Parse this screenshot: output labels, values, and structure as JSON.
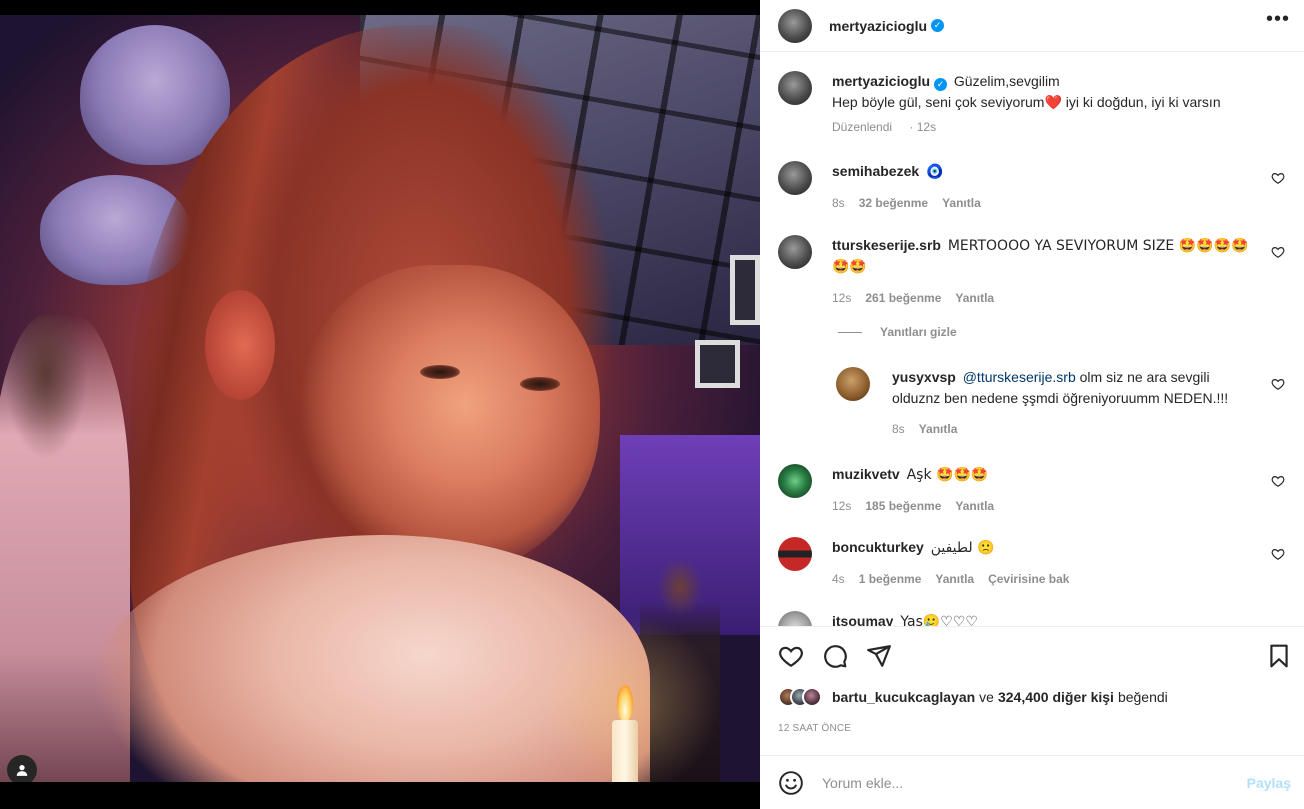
{
  "post": {
    "author": "mertyazicioglu",
    "caption_line1": "Güzelim,sevgilim",
    "caption_line2_part1": "Hep böyle gül, seni çok seviyorum",
    "caption_heart": "❤️",
    "caption_line2_part2": " iyi ki doğdun, iyi ki varsın",
    "edited": "Düzenlendi",
    "edited_time": "12s"
  },
  "comments": [
    {
      "user": "semihabezek",
      "text": "🧿",
      "time": "8s",
      "likes": "32 beğenme",
      "reply": "Yanıtla"
    },
    {
      "user": "tturskeserije.srb",
      "text": "MERTOOOO YA SEVIYORUM SIZE 🤩🤩🤩🤩",
      "text2": "🤩🤩",
      "time": "12s",
      "likes": "261 beğenme",
      "reply": "Yanıtla"
    },
    {
      "user": "yusyxvsp",
      "mention": "@tturskeserije.srb",
      "text": " olm siz ne ara sevgili",
      "text2": "olduznz ben nedene şşmdi öğreniyoruumm NEDEN.!!!",
      "time": "8s",
      "reply": "Yanıtla"
    },
    {
      "user": "muzikvetv",
      "text": "Aşk 🤩🤩🤩",
      "time": "12s",
      "likes": "185 beğenme",
      "reply": "Yanıtla"
    },
    {
      "user": "boncukturkey",
      "text": "لطيفين 🙁",
      "time": "4s",
      "likes": "1 beğenme",
      "reply": "Yanıtla",
      "translate": "Çevirisine bak"
    },
    {
      "user": "itsoumay",
      "text": "Yas🥲♡♡♡"
    }
  ],
  "hide_replies": "Yanıtları gizle",
  "likes": {
    "user": "bartu_kucukcaglayan",
    "and": "ve",
    "count": "324,400 diğer kişi",
    "suffix": "beğendi"
  },
  "time_ago": "12 SAAT ÖNCE",
  "comment_box": {
    "placeholder": "Yorum ekle...",
    "post_label": "Paylaş"
  },
  "icons": {
    "more": "more-horizontal-icon",
    "like": "heart-icon",
    "comment": "comment-icon",
    "share": "send-icon",
    "save": "bookmark-icon",
    "emoji": "emoji-icon",
    "tag": "user-tag-icon"
  },
  "colors": {
    "verified": "#0095f6",
    "post_button": "#b2dffc",
    "meta_text": "#8e8e8e"
  }
}
